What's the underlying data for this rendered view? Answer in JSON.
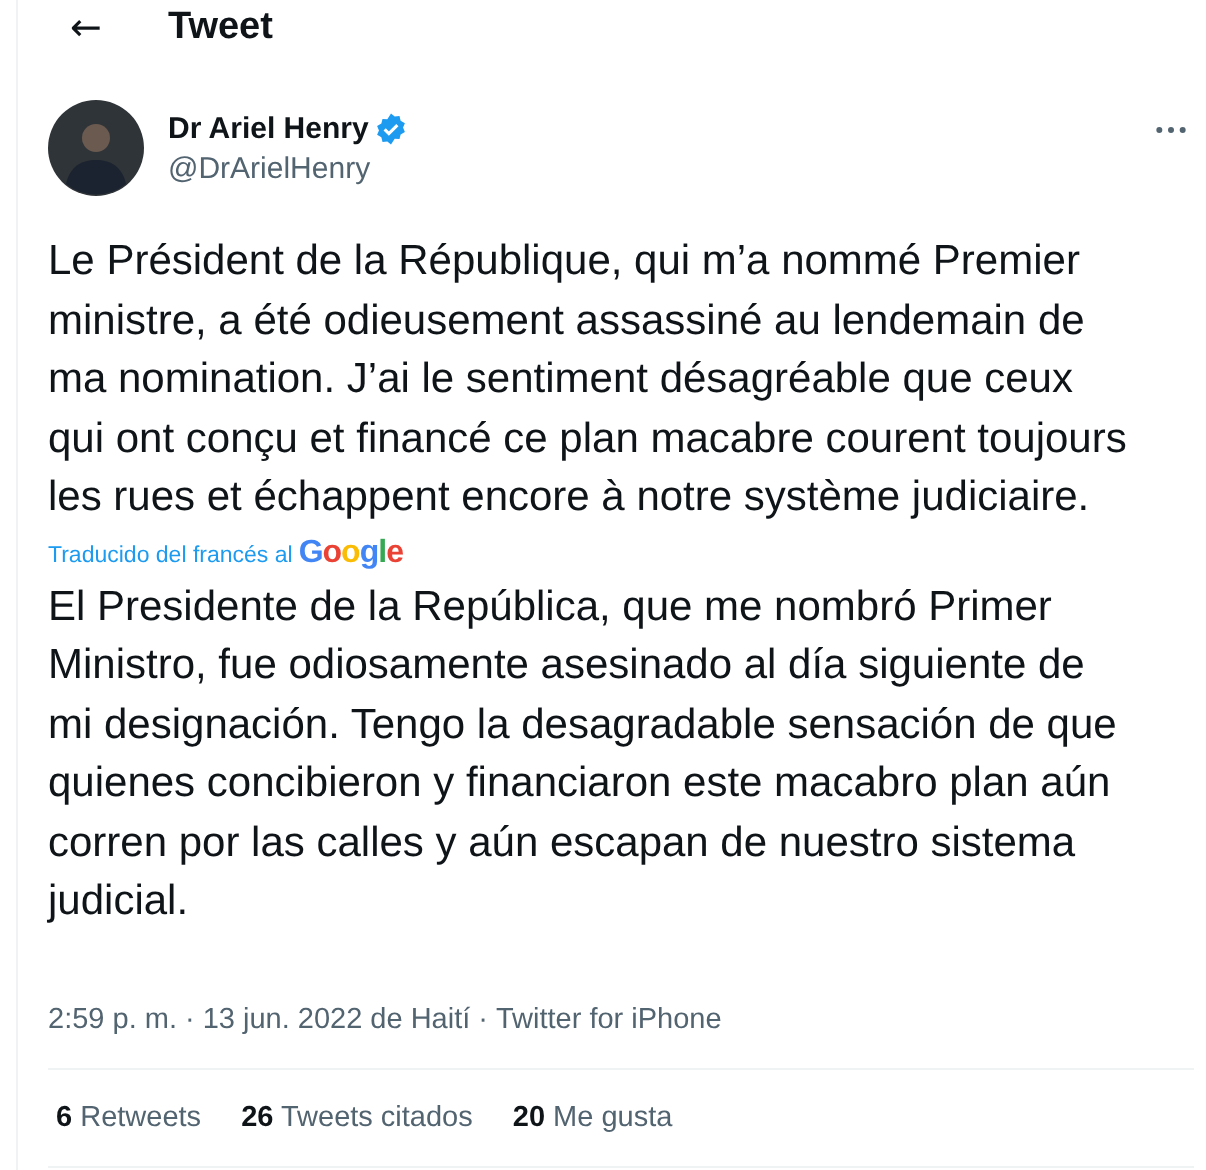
{
  "header": {
    "back": "←",
    "title": "Tweet"
  },
  "author": {
    "name": "Dr Ariel Henry",
    "verified": true,
    "handle": "@DrArielHenry"
  },
  "tweet": {
    "text": "Le Président de la République, qui m’a nommé Premier ministre, a été odieusement assassiné au lendemain de ma nomination. J’ai le sentiment désagréable que ceux qui ont conçu et financé ce plan macabre courent toujours les rues et échappent encore à notre système judiciaire.",
    "translation_note": "Traducido del francés al",
    "translation_brand": "Google",
    "translation": "El Presidente de la República, que me nombró Primer Ministro, fue odiosamente asesinado al día siguiente de mi designación. Tengo la desagradable sensación de que quienes concibieron y financiaron este macabro plan aún corren por las calles y aún escapan de nuestro sistema judicial.",
    "time": "2:59 p. m.",
    "separator_1": "·",
    "date": "13 jun. 2022",
    "place": "de Haití",
    "separator_2": "·",
    "source": "Twitter for iPhone"
  },
  "stats": [
    {
      "count": "6",
      "label": "Retweets"
    },
    {
      "count": "26",
      "label": "Tweets citados"
    },
    {
      "count": "20",
      "label": "Me gusta"
    }
  ]
}
